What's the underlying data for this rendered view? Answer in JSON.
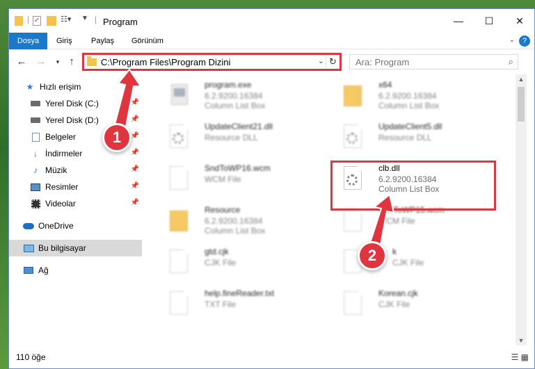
{
  "window": {
    "title": "Program",
    "controls": {
      "minimize": "—",
      "maximize": "☐",
      "close": "✕"
    }
  },
  "ribbon": {
    "tabs": [
      "Dosya",
      "Giriş",
      "Paylaş",
      "Görünüm"
    ],
    "help_label": "?"
  },
  "address_bar": {
    "path": "C:\\Program Files\\Program Dizini"
  },
  "search": {
    "placeholder": "Ara: Program"
  },
  "sidebar": {
    "items": [
      {
        "label": "Hızlı erişim",
        "icon": "star-icon"
      },
      {
        "label": "Yerel Disk (C:)",
        "icon": "drive-icon",
        "pinned": true
      },
      {
        "label": "Yerel Disk (D:)",
        "icon": "drive-icon",
        "pinned": true
      },
      {
        "label": "Belgeler",
        "icon": "documents-icon",
        "pinned": true
      },
      {
        "label": "İndirmeler",
        "icon": "download-icon",
        "pinned": true
      },
      {
        "label": "Müzik",
        "icon": "music-icon",
        "pinned": true
      },
      {
        "label": "Resimler",
        "icon": "pictures-icon",
        "pinned": true
      },
      {
        "label": "Videolar",
        "icon": "videos-icon",
        "pinned": true
      },
      {
        "label": "OneDrive",
        "icon": "cloud-icon"
      },
      {
        "label": "Bu bilgisayar",
        "icon": "computer-icon",
        "selected": true
      },
      {
        "label": "Ağ",
        "icon": "network-icon"
      }
    ]
  },
  "files": [
    {
      "name": "program.exe",
      "line1": "6.2.9200.16384",
      "line2": "Column List Box"
    },
    {
      "name": "x64",
      "line1": "6.2.9200.16384",
      "line2": "Column List Box"
    },
    {
      "name": "UpdateClient21.dll",
      "line1": "Resource DLL",
      "line2": ""
    },
    {
      "name": "UpdateClient5.dll",
      "line1": "Resource DLL",
      "line2": ""
    },
    {
      "name": "SndToWP16.wcm",
      "line1": "WCM File",
      "line2": ""
    },
    {
      "name": "clb.dll",
      "line1": "6.2.9200.16384",
      "line2": "Column List Box"
    },
    {
      "name": "Resource",
      "line1": "6.2.9200.16384",
      "line2": "Column List Box"
    },
    {
      "name": "SndToWP15.wcm",
      "line1": "WCM File",
      "line2": ""
    },
    {
      "name": "gtd.cjk",
      "line1": "CJK File",
      "line2": ""
    },
    {
      "name": "k",
      "line1": "CJK File",
      "line2": ""
    },
    {
      "name": "help.fineReader.txt",
      "line1": "TXT File",
      "line2": ""
    },
    {
      "name": "Korean.cjk",
      "line1": "CJK File",
      "line2": ""
    }
  ],
  "status": {
    "item_count": "110 öğe"
  },
  "annotations": {
    "step1": "1",
    "step2": "2",
    "color": "#e0353e"
  }
}
